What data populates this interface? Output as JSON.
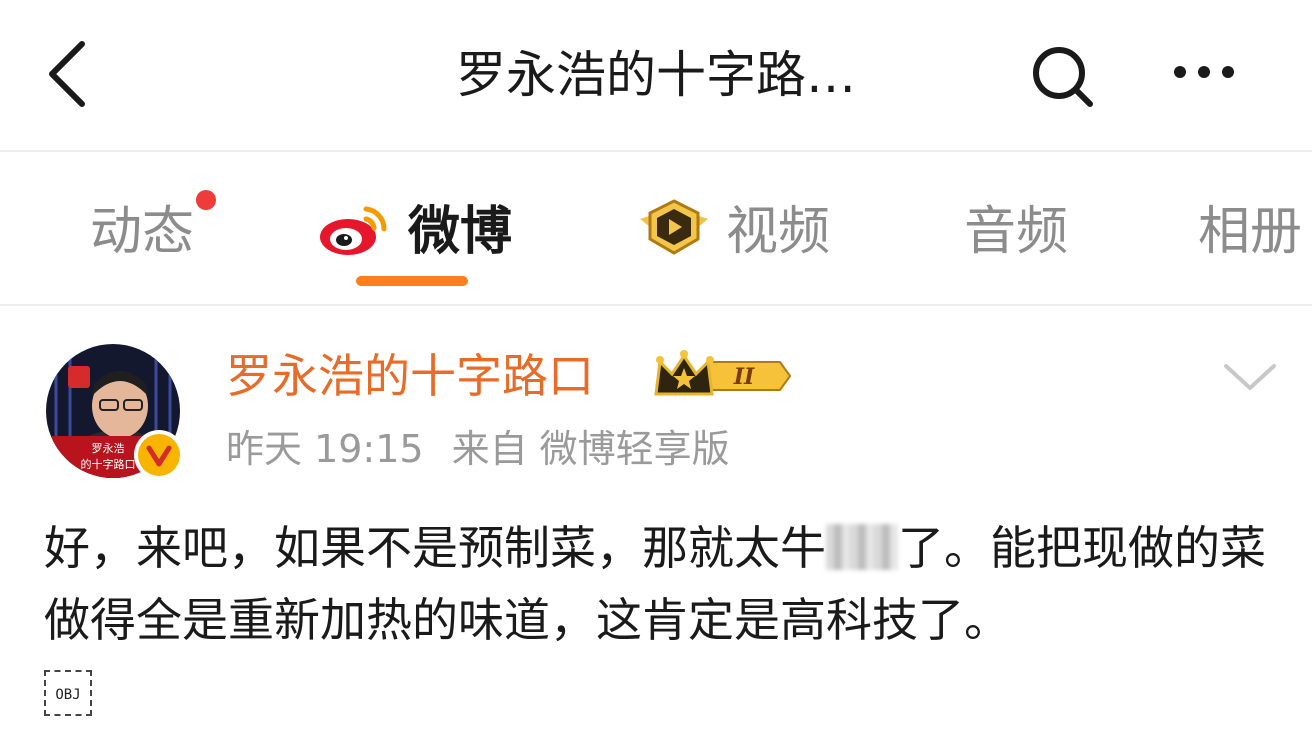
{
  "header": {
    "title": "罗永浩的十字路…",
    "back_icon": "chevron-left-icon",
    "search_icon": "search-icon",
    "more_icon": "more-horizontal-icon"
  },
  "tabs": [
    {
      "label": "动态",
      "has_dot": true
    },
    {
      "label": "微博",
      "active": true,
      "icon": "weibo-logo-icon"
    },
    {
      "label": "视频",
      "icon": "video-badge-icon"
    },
    {
      "label": "音频"
    },
    {
      "label": "相册"
    }
  ],
  "post": {
    "author": "罗永浩的十字路口",
    "vip_level": "II",
    "time": "昨天 19:15",
    "source": "来自 微博轻享版",
    "text_part1": "好，来吧，如果不是预制菜，那就太牛",
    "text_part2": "了。能把现做的菜做得全是重新加热的味道，这肯定是高科技了。",
    "obj_placeholder": "OBJ",
    "avatar_caption_line1": "罗永浩",
    "avatar_caption_line2": "的十字路口"
  },
  "colors": {
    "accent": "#ff7f1e",
    "author_name": "#e86b27",
    "notification_dot": "#f03b3b",
    "inactive_tab": "#8c8c8c"
  }
}
